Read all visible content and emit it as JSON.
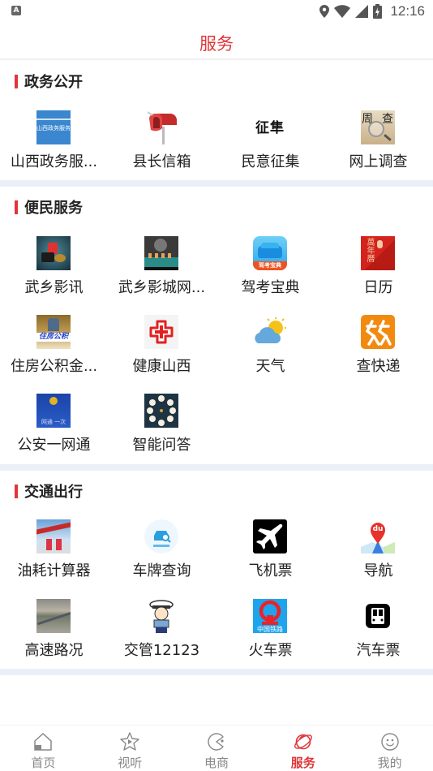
{
  "status_bar": {
    "left_icon": "a11y-notification-icon",
    "left_glyph": "A",
    "icons": [
      "location-icon",
      "wifi-icon",
      "signal-icon",
      "battery-charging-icon"
    ],
    "time": "12:16"
  },
  "header": {
    "title": "服务"
  },
  "accent_color": "#e0363a",
  "sections": [
    {
      "title": "政务公开",
      "items": [
        {
          "label": "山西政务服...",
          "icon": "shanxi-gov-service-icon"
        },
        {
          "label": "县长信箱",
          "icon": "mailbox-icon"
        },
        {
          "label": "民意征集",
          "icon": "opinion-collection-icon"
        },
        {
          "label": "网上调查",
          "icon": "online-survey-icon"
        }
      ]
    },
    {
      "title": "便民服务",
      "items": [
        {
          "label": "武乡影讯",
          "icon": "movie-news-icon"
        },
        {
          "label": "武乡影城网...",
          "icon": "cinema-icon"
        },
        {
          "label": "驾考宝典",
          "icon": "driving-test-icon",
          "icon_text": "驾考宝典"
        },
        {
          "label": "日历",
          "icon": "calendar-icon",
          "icon_text": "萬年曆"
        },
        {
          "label": "住房公积金...",
          "icon": "housing-fund-icon",
          "icon_text": "住房公积"
        },
        {
          "label": "健康山西",
          "icon": "health-cross-icon"
        },
        {
          "label": "天气",
          "icon": "weather-icon"
        },
        {
          "label": "查快递",
          "icon": "express-tracking-icon"
        },
        {
          "label": "公安一网通",
          "icon": "police-badge-icon",
          "icon_text": "网通 一次"
        },
        {
          "label": "智能问答",
          "icon": "smart-qa-icon"
        }
      ]
    },
    {
      "title": "交通出行",
      "items": [
        {
          "label": "油耗计算器",
          "icon": "gas-station-icon"
        },
        {
          "label": "车牌查询",
          "icon": "plate-query-icon"
        },
        {
          "label": "飞机票",
          "icon": "airplane-icon"
        },
        {
          "label": "导航",
          "icon": "map-navigation-icon",
          "icon_text": "du"
        },
        {
          "label": "高速路况",
          "icon": "highway-icon"
        },
        {
          "label": "交管12123",
          "icon": "traffic-police-icon"
        },
        {
          "label": "火车票",
          "icon": "railway-icon",
          "icon_text": "中国铁路"
        },
        {
          "label": "汽车票",
          "icon": "bus-icon"
        }
      ]
    }
  ],
  "bottom_nav": [
    {
      "label": "首页",
      "icon": "home-icon",
      "active": false
    },
    {
      "label": "视听",
      "icon": "video-star-icon",
      "active": false
    },
    {
      "label": "电商",
      "icon": "shop-pacman-icon",
      "active": false
    },
    {
      "label": "服务",
      "icon": "planet-service-icon",
      "active": true
    },
    {
      "label": "我的",
      "icon": "smiley-profile-icon",
      "active": false
    }
  ]
}
